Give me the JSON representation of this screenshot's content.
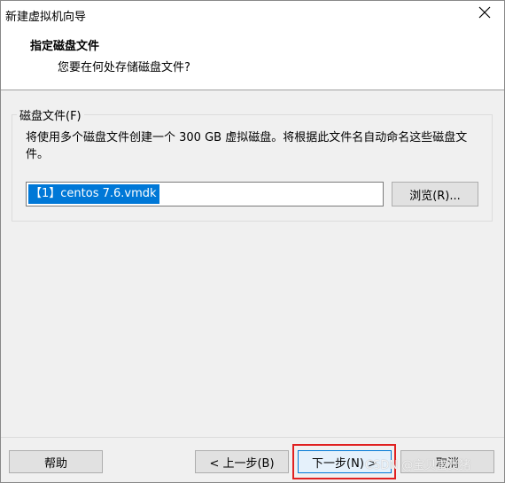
{
  "window": {
    "title": "新建虚拟机向导"
  },
  "header": {
    "title": "指定磁盘文件",
    "subtitle": "您要在何处存储磁盘文件?"
  },
  "group": {
    "legend": "磁盘文件(F)",
    "description": "将使用多个磁盘文件创建一个 300 GB 虚拟磁盘。将根据此文件名自动命名这些磁盘文件。",
    "file_value": "【1】centos 7.6.vmdk",
    "browse_label": "浏览(R)..."
  },
  "footer": {
    "help_label": "帮助",
    "back_label": "< 上一步(B)",
    "next_label": "下一步(N) >",
    "cancel_label": "取消"
  },
  "watermark": "CSDN @宝贝雷贵猪",
  "icons": {
    "close": "close-icon"
  },
  "colors": {
    "selection": "#0078d7",
    "highlight_box": "#e02020"
  }
}
